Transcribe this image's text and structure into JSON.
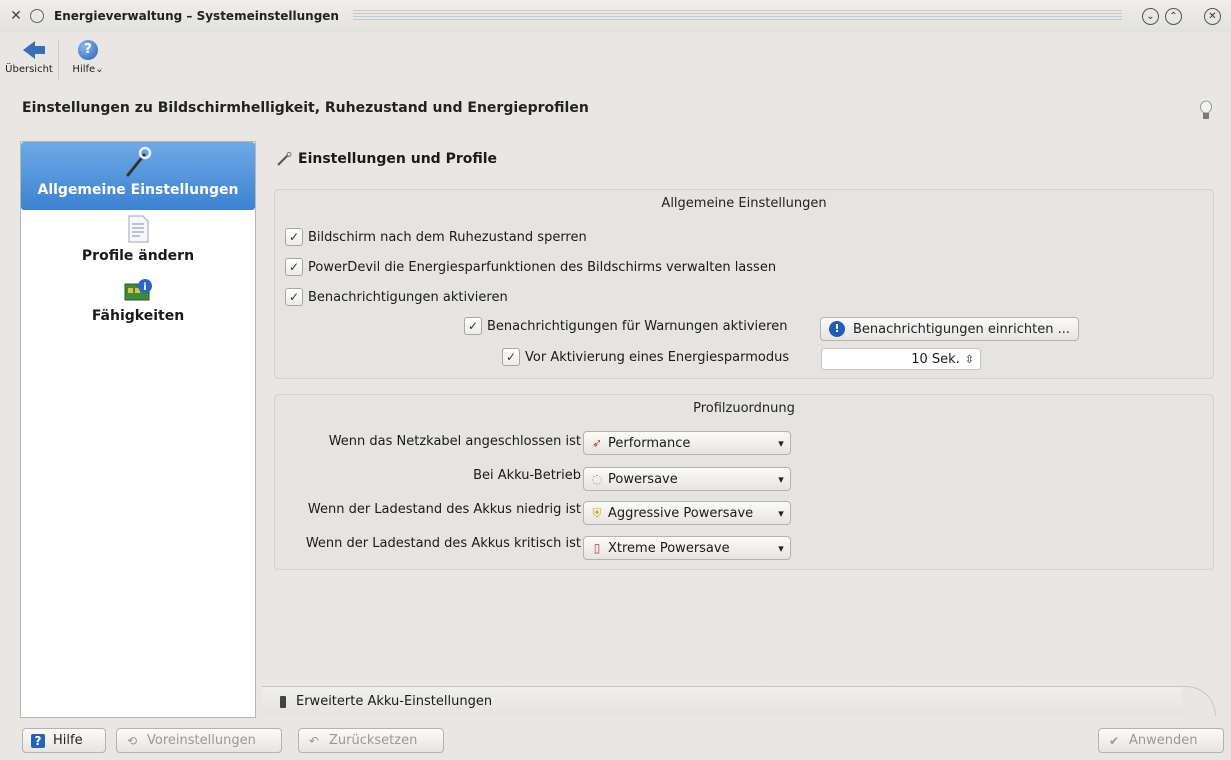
{
  "window": {
    "title": "Energieverwaltung – Systemeinstellungen",
    "icons": [
      "settings-icon",
      "minimize-circle-icon",
      "shade-down-icon",
      "shade-up-icon",
      "close-icon"
    ]
  },
  "toolbar": {
    "overview_label": "Übersicht",
    "help_label": "Hilfe"
  },
  "header": {
    "title": "Einstellungen zu Bildschirmhelligkeit, Ruhezustand und Energieprofilen"
  },
  "sidebar": {
    "items": [
      {
        "label": "Allgemeine Einstellungen",
        "icon": "wrench-icon",
        "active": true
      },
      {
        "label": "Profile ändern",
        "icon": "document-icon",
        "active": false
      },
      {
        "label": "Fähigkeiten",
        "icon": "hardware-info-icon",
        "active": false
      }
    ]
  },
  "main": {
    "title": "Einstellungen und Profile",
    "general": {
      "title": "Allgemeine Einstellungen",
      "lock_screen": "Bildschirm nach dem Ruhezustand sperren",
      "powerdevil": "PowerDevil die Energiesparfunktionen des Bildschirms verwalten lassen",
      "notifications": "Benachrichtigungen aktivieren",
      "warnings": "Benachrichtigungen für Warnungen aktivieren",
      "setup_button": "Benachrichtigungen einrichten ...",
      "before_activation": "Vor Aktivierung eines Energiesparmodus",
      "delay_value": "10 Sek."
    },
    "profiles": {
      "title": "Profilzuordnung",
      "rows": [
        {
          "label": "Wenn das Netzkabel angeschlossen ist",
          "value": "Performance",
          "icon": "rocket-icon"
        },
        {
          "label": "Bei Akku-Betrieb",
          "value": "Powersave",
          "icon": "bulb-icon"
        },
        {
          "label": "Wenn der Ladestand des Akkus niedrig ist",
          "value": "Aggressive Powersave",
          "icon": "shield-warning-icon"
        },
        {
          "label": "Wenn der Ladestand des Akkus kritisch ist",
          "value": "Xtreme Powersave",
          "icon": "battery-critical-icon"
        }
      ]
    },
    "advanced_tab": "Erweiterte Akku-Einstellungen"
  },
  "footer": {
    "help": "Hilfe",
    "defaults": "Voreinstellungen",
    "reset": "Zurücksetzen",
    "apply": "Anwenden"
  }
}
